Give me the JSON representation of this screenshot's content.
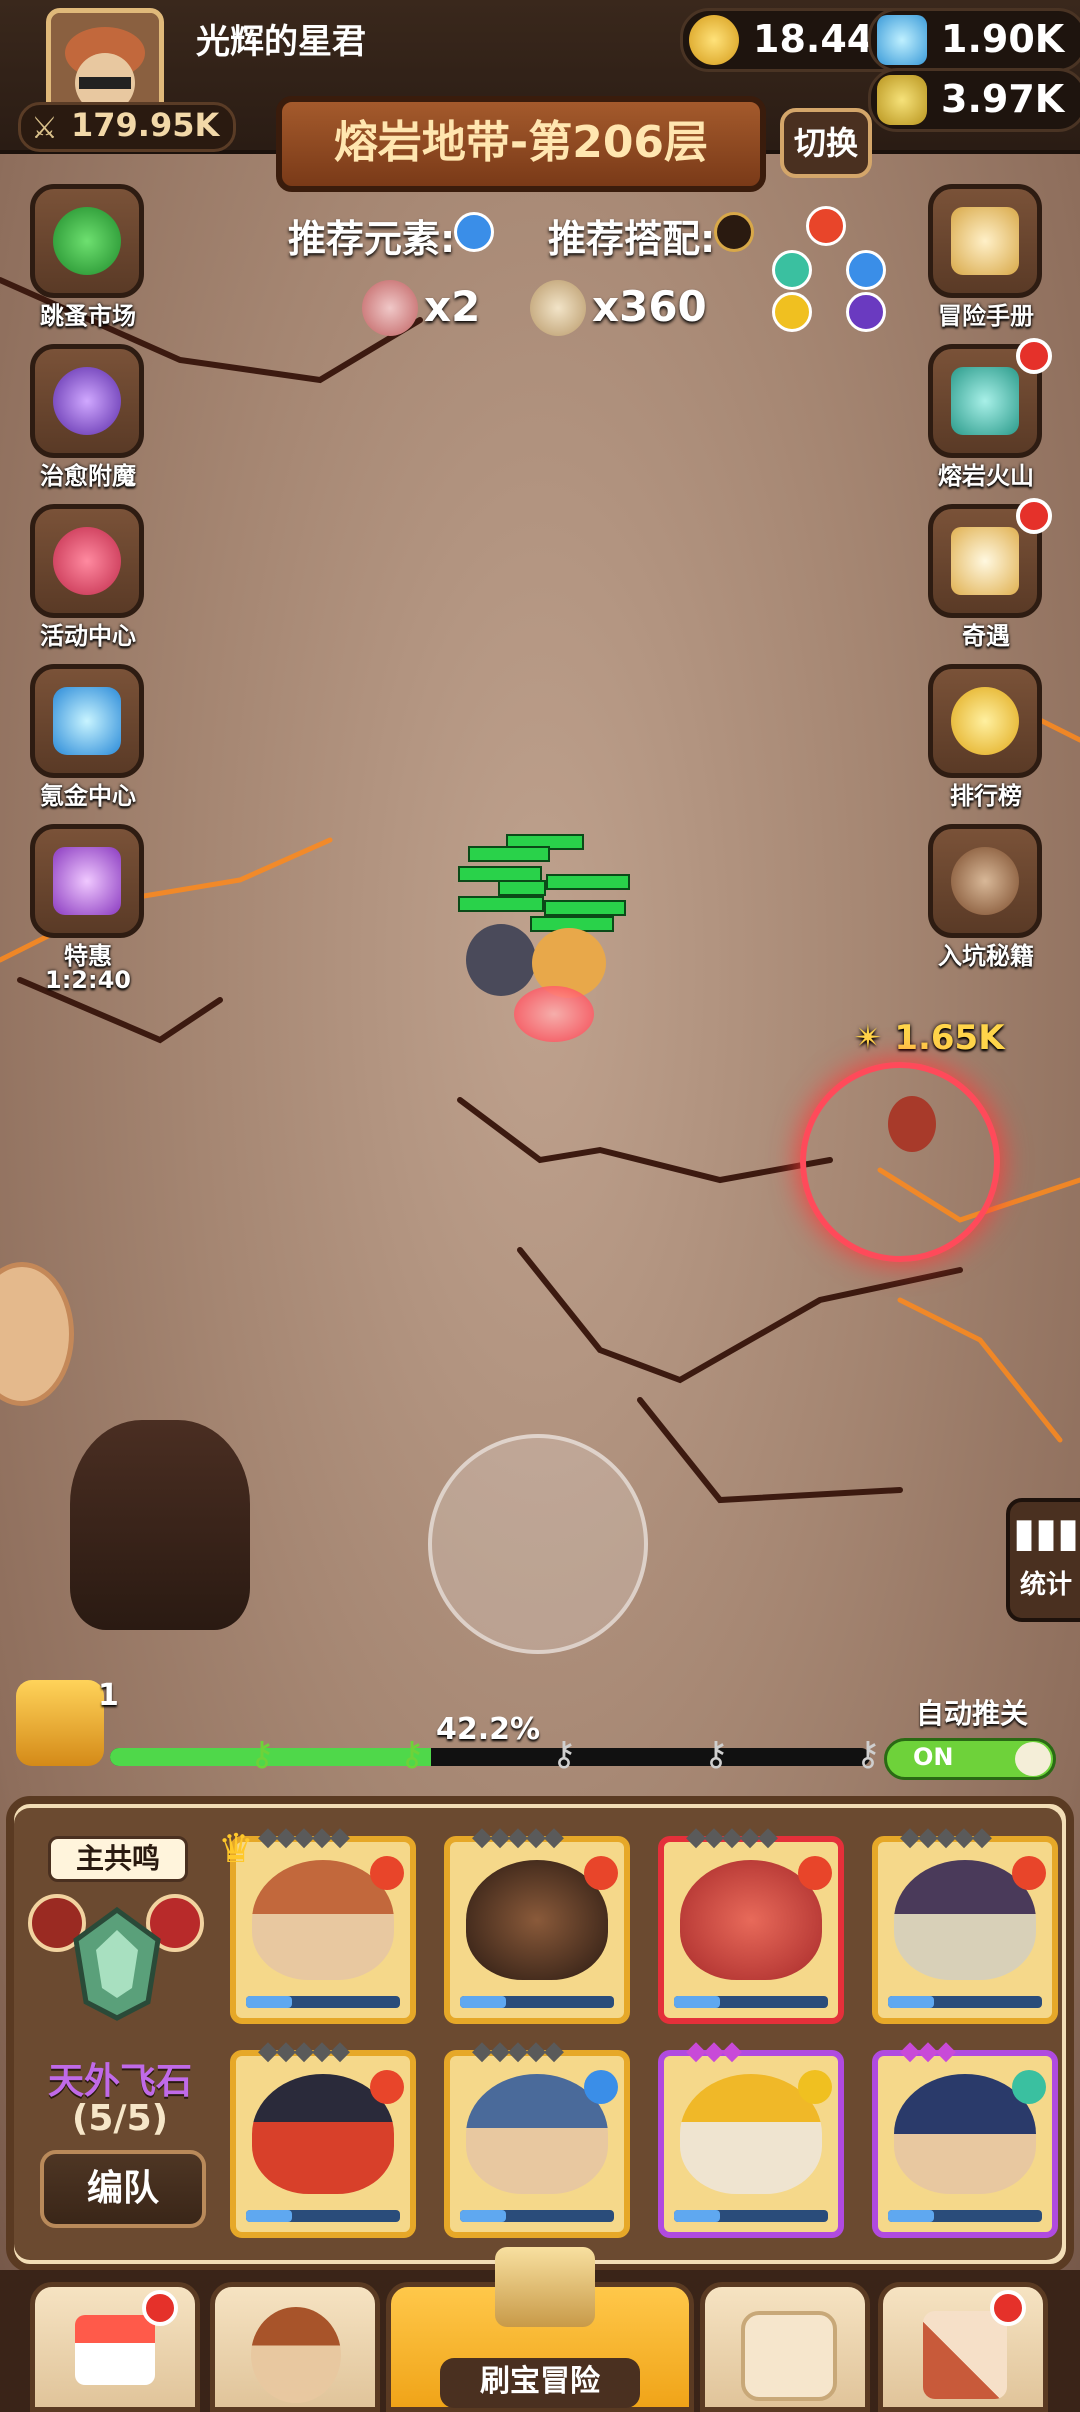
{
  "player": {
    "name": "光辉的星君",
    "power": "179.95K"
  },
  "resources": {
    "gold": "18.44K",
    "diamond": "1.90K",
    "potion": "3.97K"
  },
  "stage": {
    "title": "熔岩地带-第206层",
    "switch_label": "切换"
  },
  "recommend": {
    "element_label": "推荐元素:",
    "combo_label": "推荐搭配:",
    "elite_count": "x2",
    "normal_count": "x360"
  },
  "left_menu": [
    {
      "label": "跳蚤市场",
      "icon": "clover-icon"
    },
    {
      "label": "治愈附魔",
      "icon": "vortex-icon"
    },
    {
      "label": "活动中心",
      "icon": "bouquet-icon"
    },
    {
      "label": "氪金中心",
      "icon": "diamond-icon"
    },
    {
      "label": "特惠",
      "timer": "1:2:40",
      "icon": "chest-icon"
    }
  ],
  "right_menu": [
    {
      "label": "冒险手册",
      "icon": "scroll-icon",
      "badge": false
    },
    {
      "label": "熔岩火山",
      "icon": "treasure-chest-icon",
      "badge": true
    },
    {
      "label": "奇遇",
      "icon": "checklist-icon",
      "badge": true
    },
    {
      "label": "排行榜",
      "icon": "crown-icon",
      "badge": false
    },
    {
      "label": "入坑秘籍",
      "icon": "swords-icon",
      "badge": false
    }
  ],
  "battle": {
    "damage_text": "1.65K"
  },
  "stats_label": "统计",
  "progress": {
    "chest_count": "1",
    "percent_text": "42.2%",
    "value": 0.422
  },
  "auto_push": {
    "label": "自动推关",
    "state": "ON"
  },
  "team": {
    "resonance_label": "主共鸣",
    "name": "天外飞石",
    "count": "(5/5)",
    "formation_label": "编队",
    "heroes": [
      {
        "name": "turban-hero",
        "element": "fire",
        "rarity": "gold"
      },
      {
        "name": "burnt-hero",
        "element": "fire",
        "rarity": "gold"
      },
      {
        "name": "demon-hero",
        "element": "fire",
        "rarity": "red"
      },
      {
        "name": "witch-hero",
        "element": "fire",
        "rarity": "gold"
      },
      {
        "name": "imp-hero",
        "element": "fire",
        "rarity": "gold"
      },
      {
        "name": "diver-hero",
        "element": "water",
        "rarity": "gold"
      },
      {
        "name": "king-hero",
        "element": "light",
        "rarity": "purple"
      },
      {
        "name": "pirate-hero",
        "element": "wind",
        "rarity": "purple"
      }
    ]
  },
  "bottom_nav": [
    {
      "icon": "shop-icon",
      "badge": true
    },
    {
      "icon": "hero-icon",
      "badge": false
    },
    {
      "icon": "map-icon",
      "label": "刷宝冒险",
      "active": true
    },
    {
      "icon": "backpack-icon",
      "badge": false
    },
    {
      "icon": "hammer-icon",
      "badge": true
    }
  ],
  "colors": {
    "fire": "#e8452a",
    "water": "#3a8ee8",
    "light": "#f0c020",
    "wind": "#3ac0a0",
    "accent": "#ffc84a"
  }
}
